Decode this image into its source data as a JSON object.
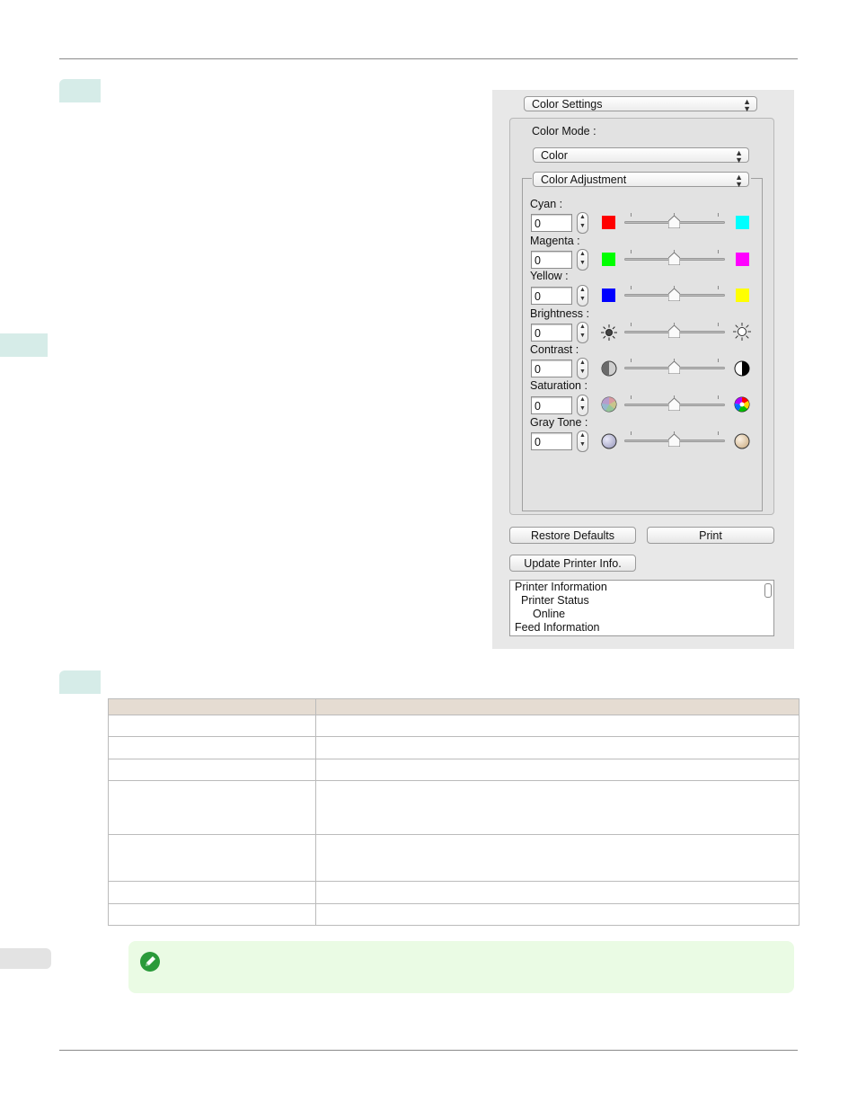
{
  "dialog": {
    "settings_popup": "Color Settings",
    "color_mode_label": "Color Mode :",
    "color_mode_value": "Color",
    "adjustment_popup": "Color Adjustment",
    "adjustments": [
      {
        "label": "Cyan :",
        "value": "0",
        "left_icon": "red-swatch",
        "right_icon": "cyan-swatch",
        "left_color": "#ff0000",
        "right_color": "#00ffff"
      },
      {
        "label": "Magenta :",
        "value": "0",
        "left_icon": "green-swatch",
        "right_icon": "magenta-swatch",
        "left_color": "#00ff00",
        "right_color": "#ff00ff"
      },
      {
        "label": "Yellow :",
        "value": "0",
        "left_icon": "blue-swatch",
        "right_icon": "yellow-swatch",
        "left_color": "#0000ff",
        "right_color": "#ffff00"
      },
      {
        "label": "Brightness :",
        "value": "0",
        "left_icon": "sun-dark-icon",
        "right_icon": "sun-light-icon"
      },
      {
        "label": "Contrast :",
        "value": "0",
        "left_icon": "contrast-low-icon",
        "right_icon": "contrast-high-icon"
      },
      {
        "label": "Saturation :",
        "value": "0",
        "left_icon": "saturation-low-icon",
        "right_icon": "saturation-high-icon"
      },
      {
        "label": "Gray Tone :",
        "value": "0",
        "left_icon": "gray-tone-cool-icon",
        "right_icon": "gray-tone-warm-icon"
      }
    ],
    "restore_defaults_label": "Restore Defaults",
    "print_label": "Print",
    "update_printer_info_label": "Update Printer Info.",
    "printer_info_lines": [
      "Printer Information",
      "Printer Status",
      "Online",
      "Feed Information"
    ]
  }
}
